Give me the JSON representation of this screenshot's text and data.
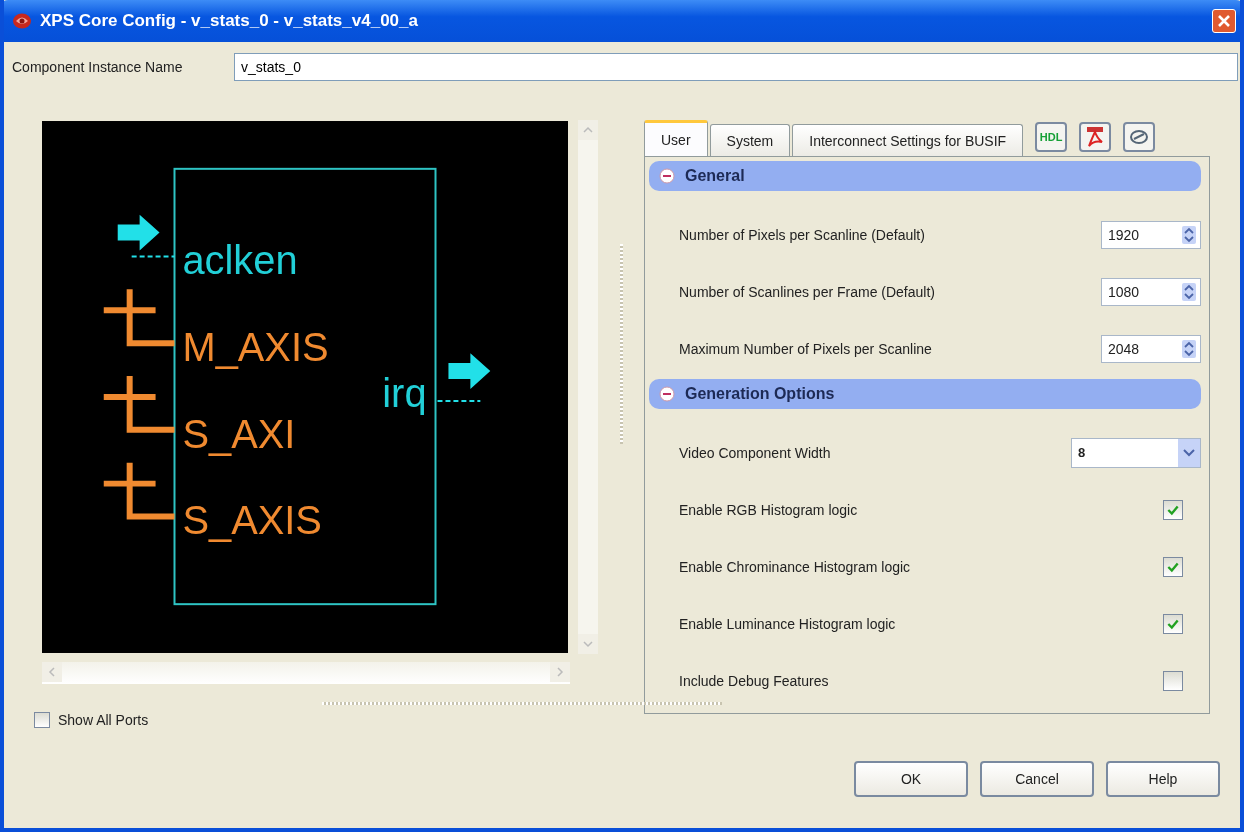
{
  "window": {
    "title": "XPS Core Config - v_stats_0 - v_stats_v4_00_a"
  },
  "instance_name": {
    "label": "Component Instance Name",
    "value": "v_stats_0"
  },
  "diagram": {
    "ports": [
      {
        "name": "aclken",
        "kind": "input"
      },
      {
        "name": "M_AXIS",
        "kind": "bus"
      },
      {
        "name": "S_AXI",
        "kind": "bus"
      },
      {
        "name": "S_AXIS",
        "kind": "bus"
      },
      {
        "name": "irq",
        "kind": "output"
      }
    ]
  },
  "show_all_ports": {
    "label": "Show All Ports",
    "checked": false
  },
  "tabs": [
    {
      "label": "User",
      "selected": true
    },
    {
      "label": "System",
      "selected": false
    },
    {
      "label": "Interconnect Settings for BUSIF",
      "selected": false
    }
  ],
  "toolbar": [
    {
      "kind": "hdl",
      "label": "HDL"
    },
    {
      "kind": "pdf"
    },
    {
      "kind": "link"
    }
  ],
  "sections": [
    {
      "title": "General",
      "expanded": true,
      "params": [
        {
          "kind": "spinner",
          "label": "Number of Pixels per Scanline (Default)",
          "value": "1920"
        },
        {
          "kind": "spinner",
          "label": "Number of Scanlines per Frame (Default)",
          "value": "1080"
        },
        {
          "kind": "spinner",
          "label": "Maximum Number of Pixels per Scanline",
          "value": "2048"
        }
      ]
    },
    {
      "title": "Generation Options",
      "expanded": true,
      "params": [
        {
          "kind": "dropdown",
          "label": "Video Component Width",
          "value": "8"
        },
        {
          "kind": "checkbox",
          "label": "Enable RGB Histogram logic",
          "checked": true
        },
        {
          "kind": "checkbox",
          "label": "Enable Chrominance Histogram logic",
          "checked": true
        },
        {
          "kind": "checkbox",
          "label": "Enable Luminance Histogram logic",
          "checked": true
        },
        {
          "kind": "checkbox",
          "label": "Include Debug Features",
          "checked": false
        }
      ]
    }
  ],
  "buttons": [
    "OK",
    "Cancel",
    "Help"
  ]
}
